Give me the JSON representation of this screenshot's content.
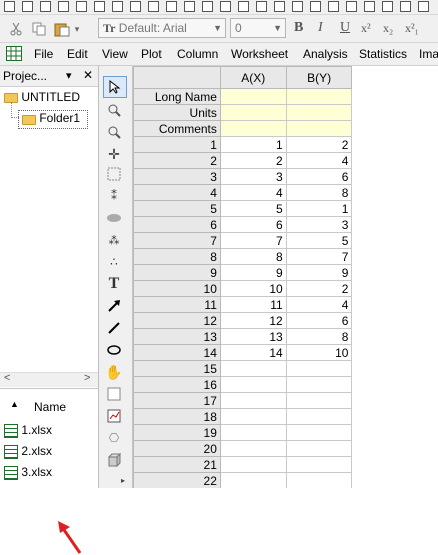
{
  "toolbar": {
    "font_name": "Default: Arial",
    "font_size": "0",
    "bold": "B",
    "italic": "I",
    "underline": "U",
    "superscript": "x²",
    "subscript": "x₂",
    "supersub": "x²₁"
  },
  "menu": {
    "file": "File",
    "edit": "Edit",
    "view": "View",
    "plot": "Plot",
    "column": "Column",
    "worksheet": "Worksheet",
    "analysis": "Analysis",
    "statistics": "Statistics",
    "image": "Ima"
  },
  "project": {
    "title": "Projec...",
    "pin": "▾ ✕",
    "root": "UNTITLED",
    "folder": "Folder1",
    "list_header": "Name",
    "files": [
      "1.xlsx",
      "2.xlsx",
      "3.xlsx"
    ]
  },
  "sheet": {
    "columns": [
      "A(X)",
      "B(Y)"
    ],
    "header_rows": [
      "Long Name",
      "Units",
      "Comments"
    ],
    "rows": [
      [
        "1",
        "1",
        "2"
      ],
      [
        "2",
        "2",
        "4"
      ],
      [
        "3",
        "3",
        "6"
      ],
      [
        "4",
        "4",
        "8"
      ],
      [
        "5",
        "5",
        "1"
      ],
      [
        "6",
        "6",
        "3"
      ],
      [
        "7",
        "7",
        "5"
      ],
      [
        "8",
        "8",
        "7"
      ],
      [
        "9",
        "9",
        "9"
      ],
      [
        "10",
        "10",
        "2"
      ],
      [
        "11",
        "11",
        "4"
      ],
      [
        "12",
        "12",
        "6"
      ],
      [
        "13",
        "13",
        "8"
      ],
      [
        "14",
        "14",
        "10"
      ],
      [
        "15",
        "",
        ""
      ],
      [
        "16",
        "",
        ""
      ],
      [
        "17",
        "",
        ""
      ],
      [
        "18",
        "",
        ""
      ],
      [
        "19",
        "",
        ""
      ],
      [
        "20",
        "",
        ""
      ],
      [
        "21",
        "",
        ""
      ],
      [
        "22",
        "",
        ""
      ]
    ]
  },
  "colors": {
    "header_yellow": "#ffffd5",
    "arrow_red": "#e02020"
  }
}
